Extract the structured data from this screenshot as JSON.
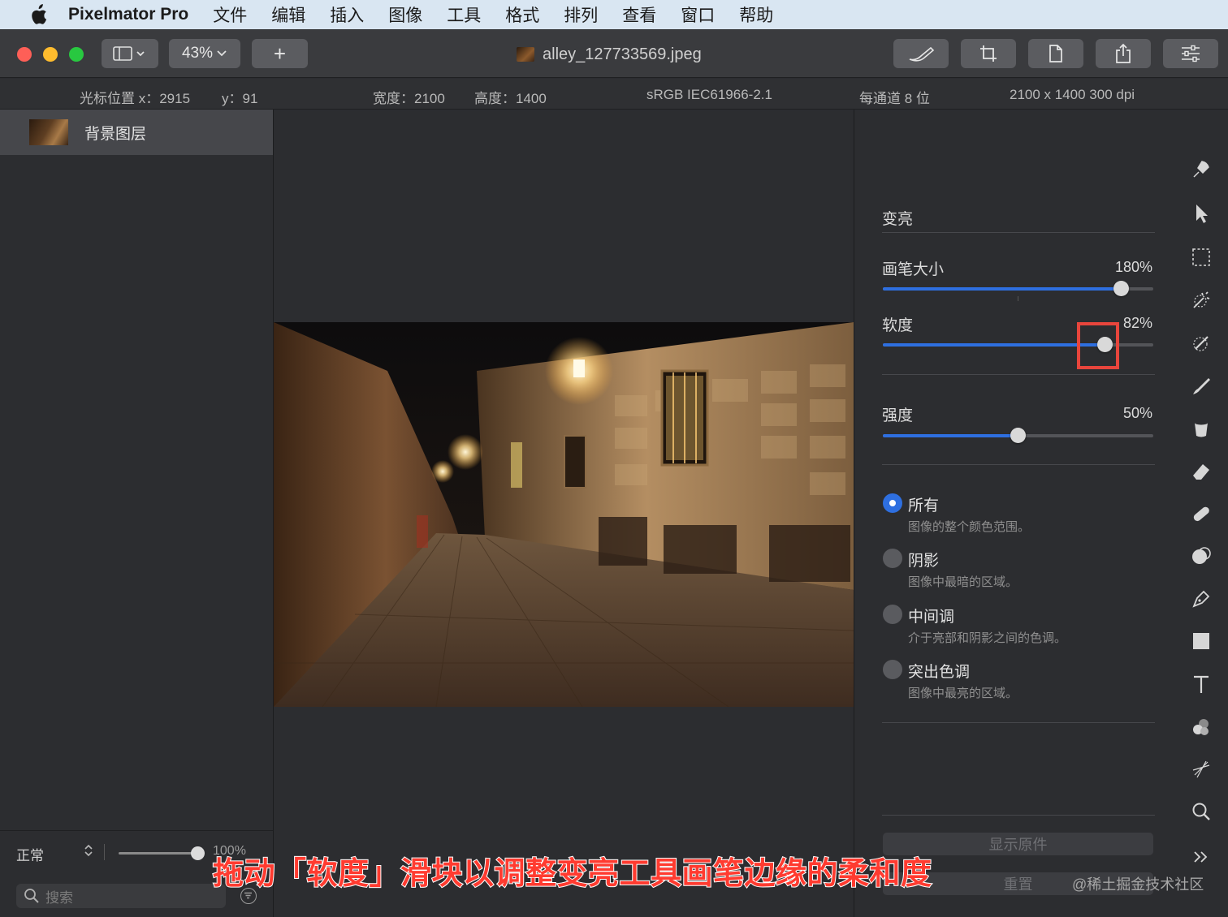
{
  "menubar": {
    "app_name": "Pixelmator Pro",
    "items": [
      "文件",
      "编辑",
      "插入",
      "图像",
      "工具",
      "格式",
      "排列",
      "查看",
      "窗口",
      "帮助"
    ]
  },
  "toolbar": {
    "zoom": "43%",
    "add_label": "+",
    "document_title": "alley_127733569.jpeg",
    "traffic_colors": [
      "#fe5f57",
      "#febc2e",
      "#28c840"
    ]
  },
  "infobar": {
    "cursor_x": "光标位置 x：2915",
    "cursor_y": "y：91",
    "width": "宽度：2100",
    "height": "高度：1400",
    "color_profile": "sRGB IEC61966-2.1",
    "bit_depth": "每通道 8 位",
    "dimensions": "2100 x 1400 300 dpi"
  },
  "layers": {
    "layer_name": "背景图层",
    "blend_mode": "正常",
    "opacity_label": "100%",
    "search_placeholder": "搜索"
  },
  "options": {
    "tool_name": "变亮",
    "brush_size": {
      "label": "画笔大小",
      "value": "180%",
      "fraction": 0.88
    },
    "softness": {
      "label": "软度",
      "value": "82%",
      "fraction": 0.82
    },
    "strength": {
      "label": "强度",
      "value": "50%",
      "fraction": 0.5
    },
    "ranges": [
      {
        "title": "所有",
        "desc": "图像的整个颜色范围。",
        "selected": true
      },
      {
        "title": "阴影",
        "desc": "图像中最暗的区域。",
        "selected": false
      },
      {
        "title": "中间调",
        "desc": "介于亮部和阴影之间的色调。",
        "selected": false
      },
      {
        "title": "突出色调",
        "desc": "图像中最亮的区域。",
        "selected": false
      }
    ],
    "show_original": "显示原件",
    "reset": "重置",
    "accent_color": "#2e6fe0"
  },
  "tools": [
    "paint-bucket-icon",
    "arrow-select-icon",
    "rect-select-icon",
    "magic-wand-icon",
    "color-picker-icon",
    "brush-icon",
    "fill-icon",
    "eraser-icon",
    "repair-icon",
    "clone-icon",
    "pen-icon",
    "shape-icon",
    "text-icon",
    "effects-icon",
    "retouch-icon",
    "zoom-icon",
    "more-icon"
  ],
  "caption": "拖动「软度」滑块以调整变亮工具画笔边缘的柔和度",
  "watermark": "@稀土掘金技术社区"
}
